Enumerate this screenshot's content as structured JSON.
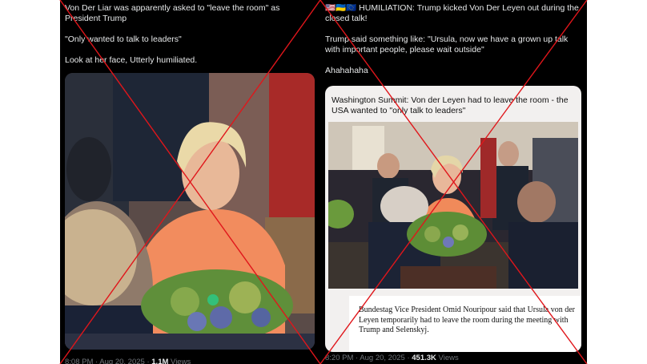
{
  "left_post": {
    "line1": "Von Der Liar was apparently asked to \"leave the room\" as President Trump",
    "line2": "\"Only wanted to talk to leaders\"",
    "line3": "Look at her face, Utterly humiliated.",
    "timestamp": "8:08 PM · Aug 20, 2025 · ",
    "views_count": "1.1M",
    "views_label": " Views"
  },
  "right_post": {
    "flags": "🇺🇸🇺🇦🇪🇺",
    "line1": " HUMILIATION: Trump kicked Von Der Leyen out during the closed talk!",
    "line2": "Trump said something like: \"Ursula, now we have a grown up talk with important people, please wait outside\"",
    "line3": "Ahahahaha",
    "quote_title": "Washington Summit: Von der Leyen had to leave the room - the USA wanted to \"only talk to leaders\"",
    "caption": "Bundestag Vice President Omid Nouripour said that Ursula von der Leyen temporarily had to leave the room during the meeting with Trump and Selenskyj.",
    "timestamp": "8:20 PM · Aug 20, 2025 · ",
    "views_count": "451.3K",
    "views_label": " Views"
  },
  "colors": {
    "cross": "#e0161b",
    "dark_bg": "#000000",
    "meta_text": "#71767b"
  },
  "icons": [
    "red-cross-mark"
  ]
}
